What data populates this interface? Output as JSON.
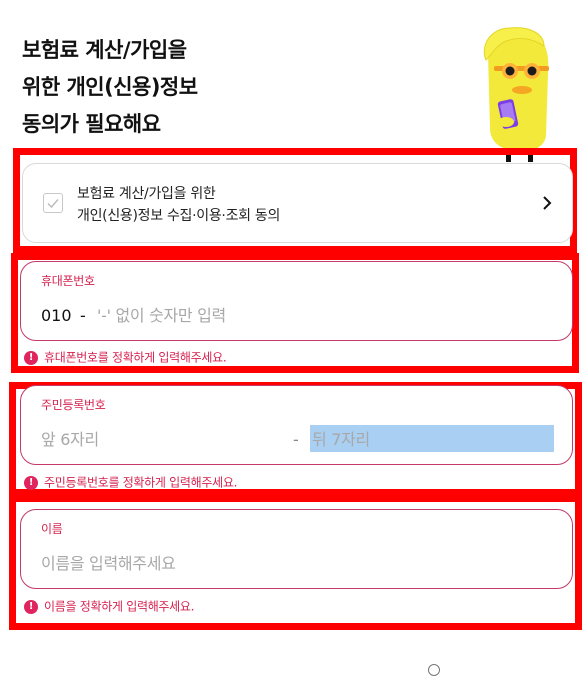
{
  "heading": {
    "line1": "보험료 계산/가입을",
    "line2": "위한 개인(신용)정보",
    "line3": "동의가 필요해요"
  },
  "consent": {
    "line1": "보험료 계산/가입을 위한",
    "line2": "개인(신용)정보 수집·이용·조회 동의",
    "checked": false
  },
  "phone": {
    "label": "휴대폰번호",
    "prefix": "010",
    "separator": "-",
    "placeholder": "'-' 없이 숫자만 입력",
    "error": "휴대폰번호를 정확하게 입력해주세요."
  },
  "rrn": {
    "label": "주민등록번호",
    "front_placeholder": "앞 6자리",
    "separator": "-",
    "back_placeholder": "뒤 7자리",
    "error": "주민등록번호를 정확하게 입력해주세요."
  },
  "name": {
    "label": "이름",
    "placeholder": "이름을 입력해주세요",
    "error": "이름을 정확하게 입력해주세요."
  },
  "colors": {
    "accent": "#d6224f",
    "error_icon": "#e0245e",
    "highlight": "#ff0000",
    "selection": "#a9cff2"
  },
  "icons": {
    "mascot": "mascot-character-icon",
    "checkbox": "check-icon",
    "chevron": "chevron-right-icon",
    "error": "error-icon"
  }
}
